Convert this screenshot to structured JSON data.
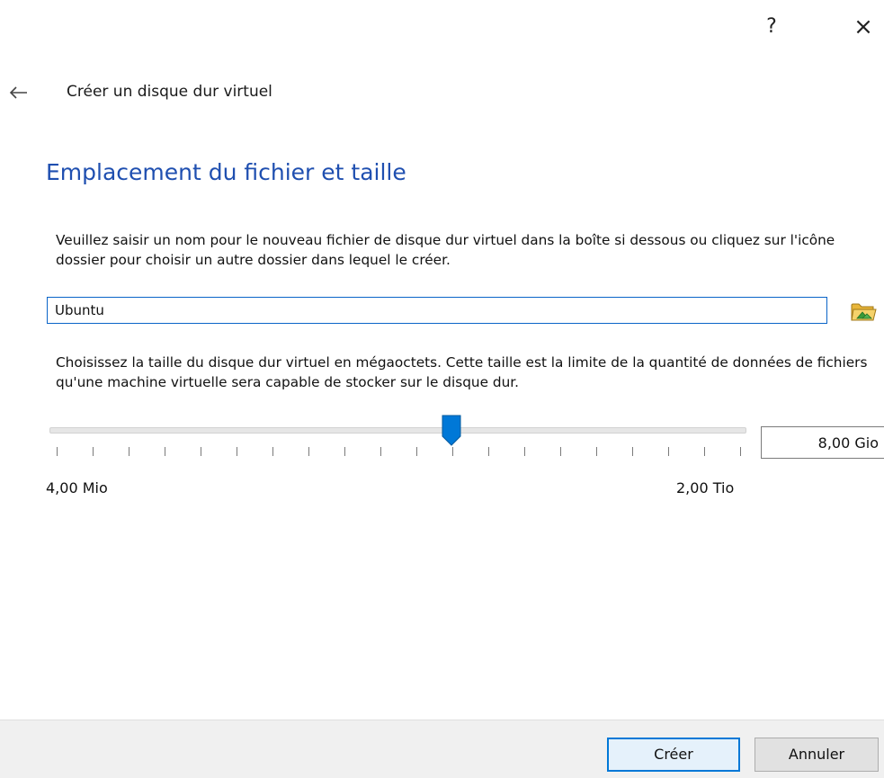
{
  "titlebar": {
    "help_label": "?",
    "close_label": "×"
  },
  "wizard": {
    "title": "Créer un disque dur virtuel",
    "heading": "Emplacement du fichier et taille",
    "name_description": "Veuillez saisir un nom pour le nouveau fichier de disque dur virtuel dans la boîte si dessous ou cliquez sur l'icône dossier pour choisir un autre dossier dans lequel le créer.",
    "name_value": "Ubuntu",
    "size_description": "Choisissez la taille du disque dur virtuel en mégaoctets. Cette taille est la limite de la quantité de données de fichiers qu'une machine virtuelle sera capable de stocker sur le disque dur.",
    "size_min_label": "4,00 Mio",
    "size_max_label": "2,00 Tio",
    "size_value": "8,00 Gio",
    "slider_position": 0.57
  },
  "footer": {
    "create_label": "Créer",
    "cancel_label": "Annuler"
  },
  "icons": {
    "back": "arrow-left-icon",
    "folder": "folder-icon",
    "slider_thumb": "slider-thumb"
  },
  "colors": {
    "heading": "#1f4fb0",
    "accent": "#0078d7",
    "folder_yellow": "#f0c040",
    "folder_green": "#3a9a3a"
  }
}
